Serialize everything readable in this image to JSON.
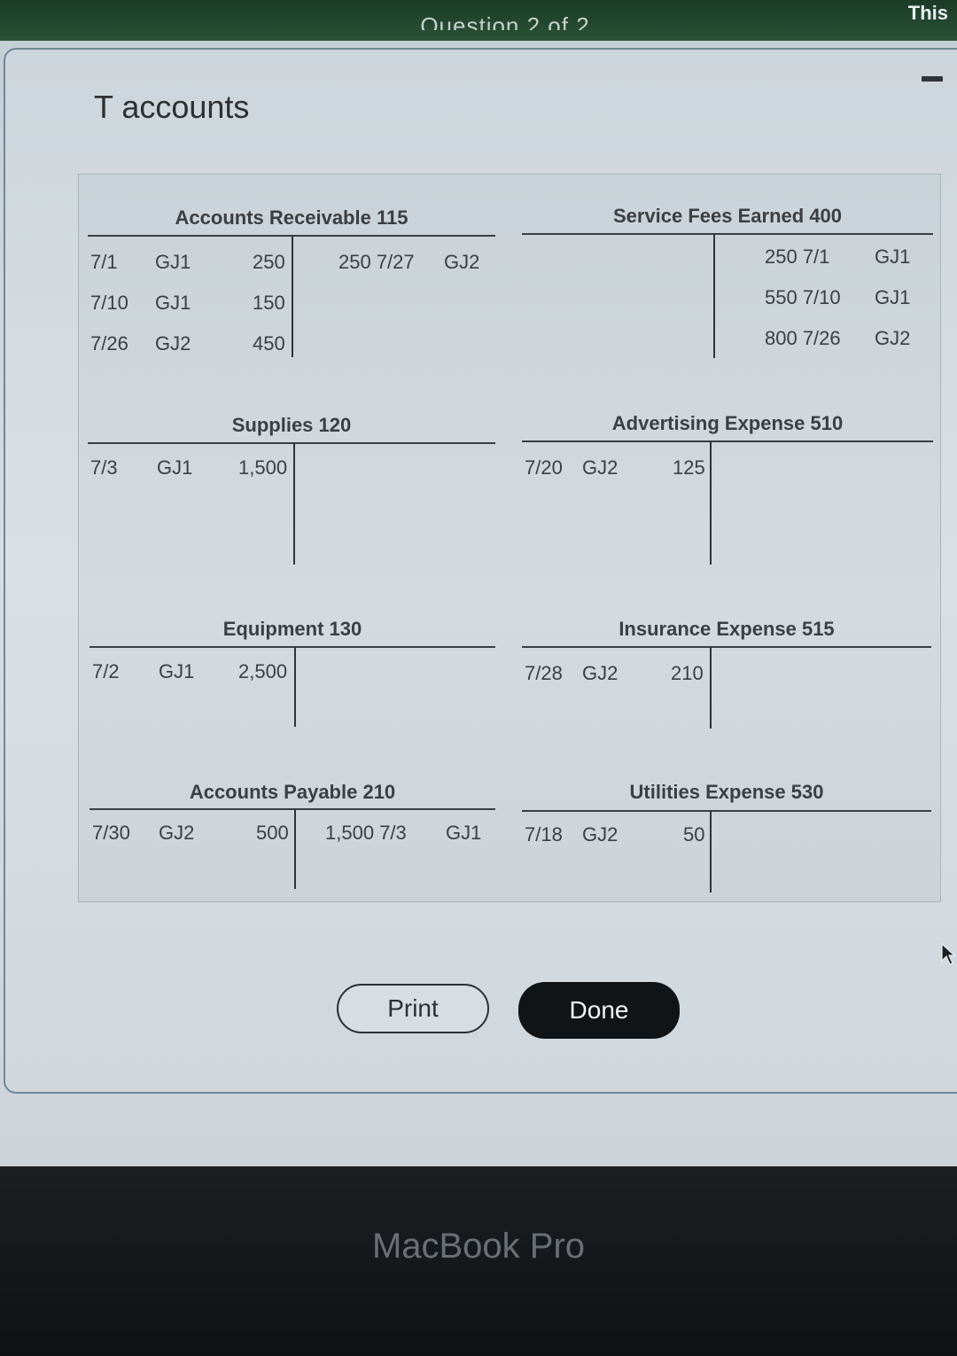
{
  "header": {
    "question_label": "Question 2 of 2",
    "corner_text": "This"
  },
  "modal": {
    "title": "T accounts",
    "minimize_icon": "minus-icon"
  },
  "accounts": {
    "accounts_receivable": {
      "title": "Accounts Receivable 115",
      "debits": [
        {
          "date": "7/1",
          "ref": "GJ1",
          "amount": "250"
        },
        {
          "date": "7/10",
          "ref": "GJ1",
          "amount": "150"
        },
        {
          "date": "7/26",
          "ref": "GJ2",
          "amount": "450"
        }
      ],
      "credits": [
        {
          "amount_date": "250 7/27",
          "ref": "GJ2"
        }
      ]
    },
    "service_fees": {
      "title": "Service Fees Earned 400",
      "credits": [
        {
          "amount_date": "250 7/1",
          "ref": "GJ1"
        },
        {
          "amount_date": "550 7/10",
          "ref": "GJ1"
        },
        {
          "amount_date": "800 7/26",
          "ref": "GJ2"
        }
      ]
    },
    "supplies": {
      "title": "Supplies 120",
      "debits": [
        {
          "date": "7/3",
          "ref": "GJ1",
          "amount": "1,500"
        }
      ]
    },
    "advertising": {
      "title": "Advertising Expense 510",
      "debits": [
        {
          "date": "7/20",
          "ref": "GJ2",
          "amount": "125"
        }
      ]
    },
    "equipment": {
      "title": "Equipment 130",
      "debits": [
        {
          "date": "7/2",
          "ref": "GJ1",
          "amount": "2,500"
        }
      ]
    },
    "insurance": {
      "title": "Insurance Expense 515",
      "debits": [
        {
          "date": "7/28",
          "ref": "GJ2",
          "amount": "210"
        }
      ]
    },
    "accounts_payable": {
      "title": "Accounts Payable 210",
      "debits": [
        {
          "date": "7/30",
          "ref": "GJ2",
          "amount": "500"
        }
      ],
      "credits": [
        {
          "amount_date": "1,500 7/3",
          "ref": "GJ1"
        }
      ]
    },
    "utilities": {
      "title": "Utilities Expense 530",
      "debits": [
        {
          "date": "7/18",
          "ref": "GJ2",
          "amount": "50"
        }
      ]
    }
  },
  "buttons": {
    "print_label": "Print",
    "done_label": "Done"
  },
  "bezel": {
    "brand": "MacBook Pro"
  },
  "colors": {
    "screen_bg": "#d3dbe0",
    "modal_border": "#6f8797",
    "done_bg": "#111416",
    "topbar": "#244a31"
  }
}
